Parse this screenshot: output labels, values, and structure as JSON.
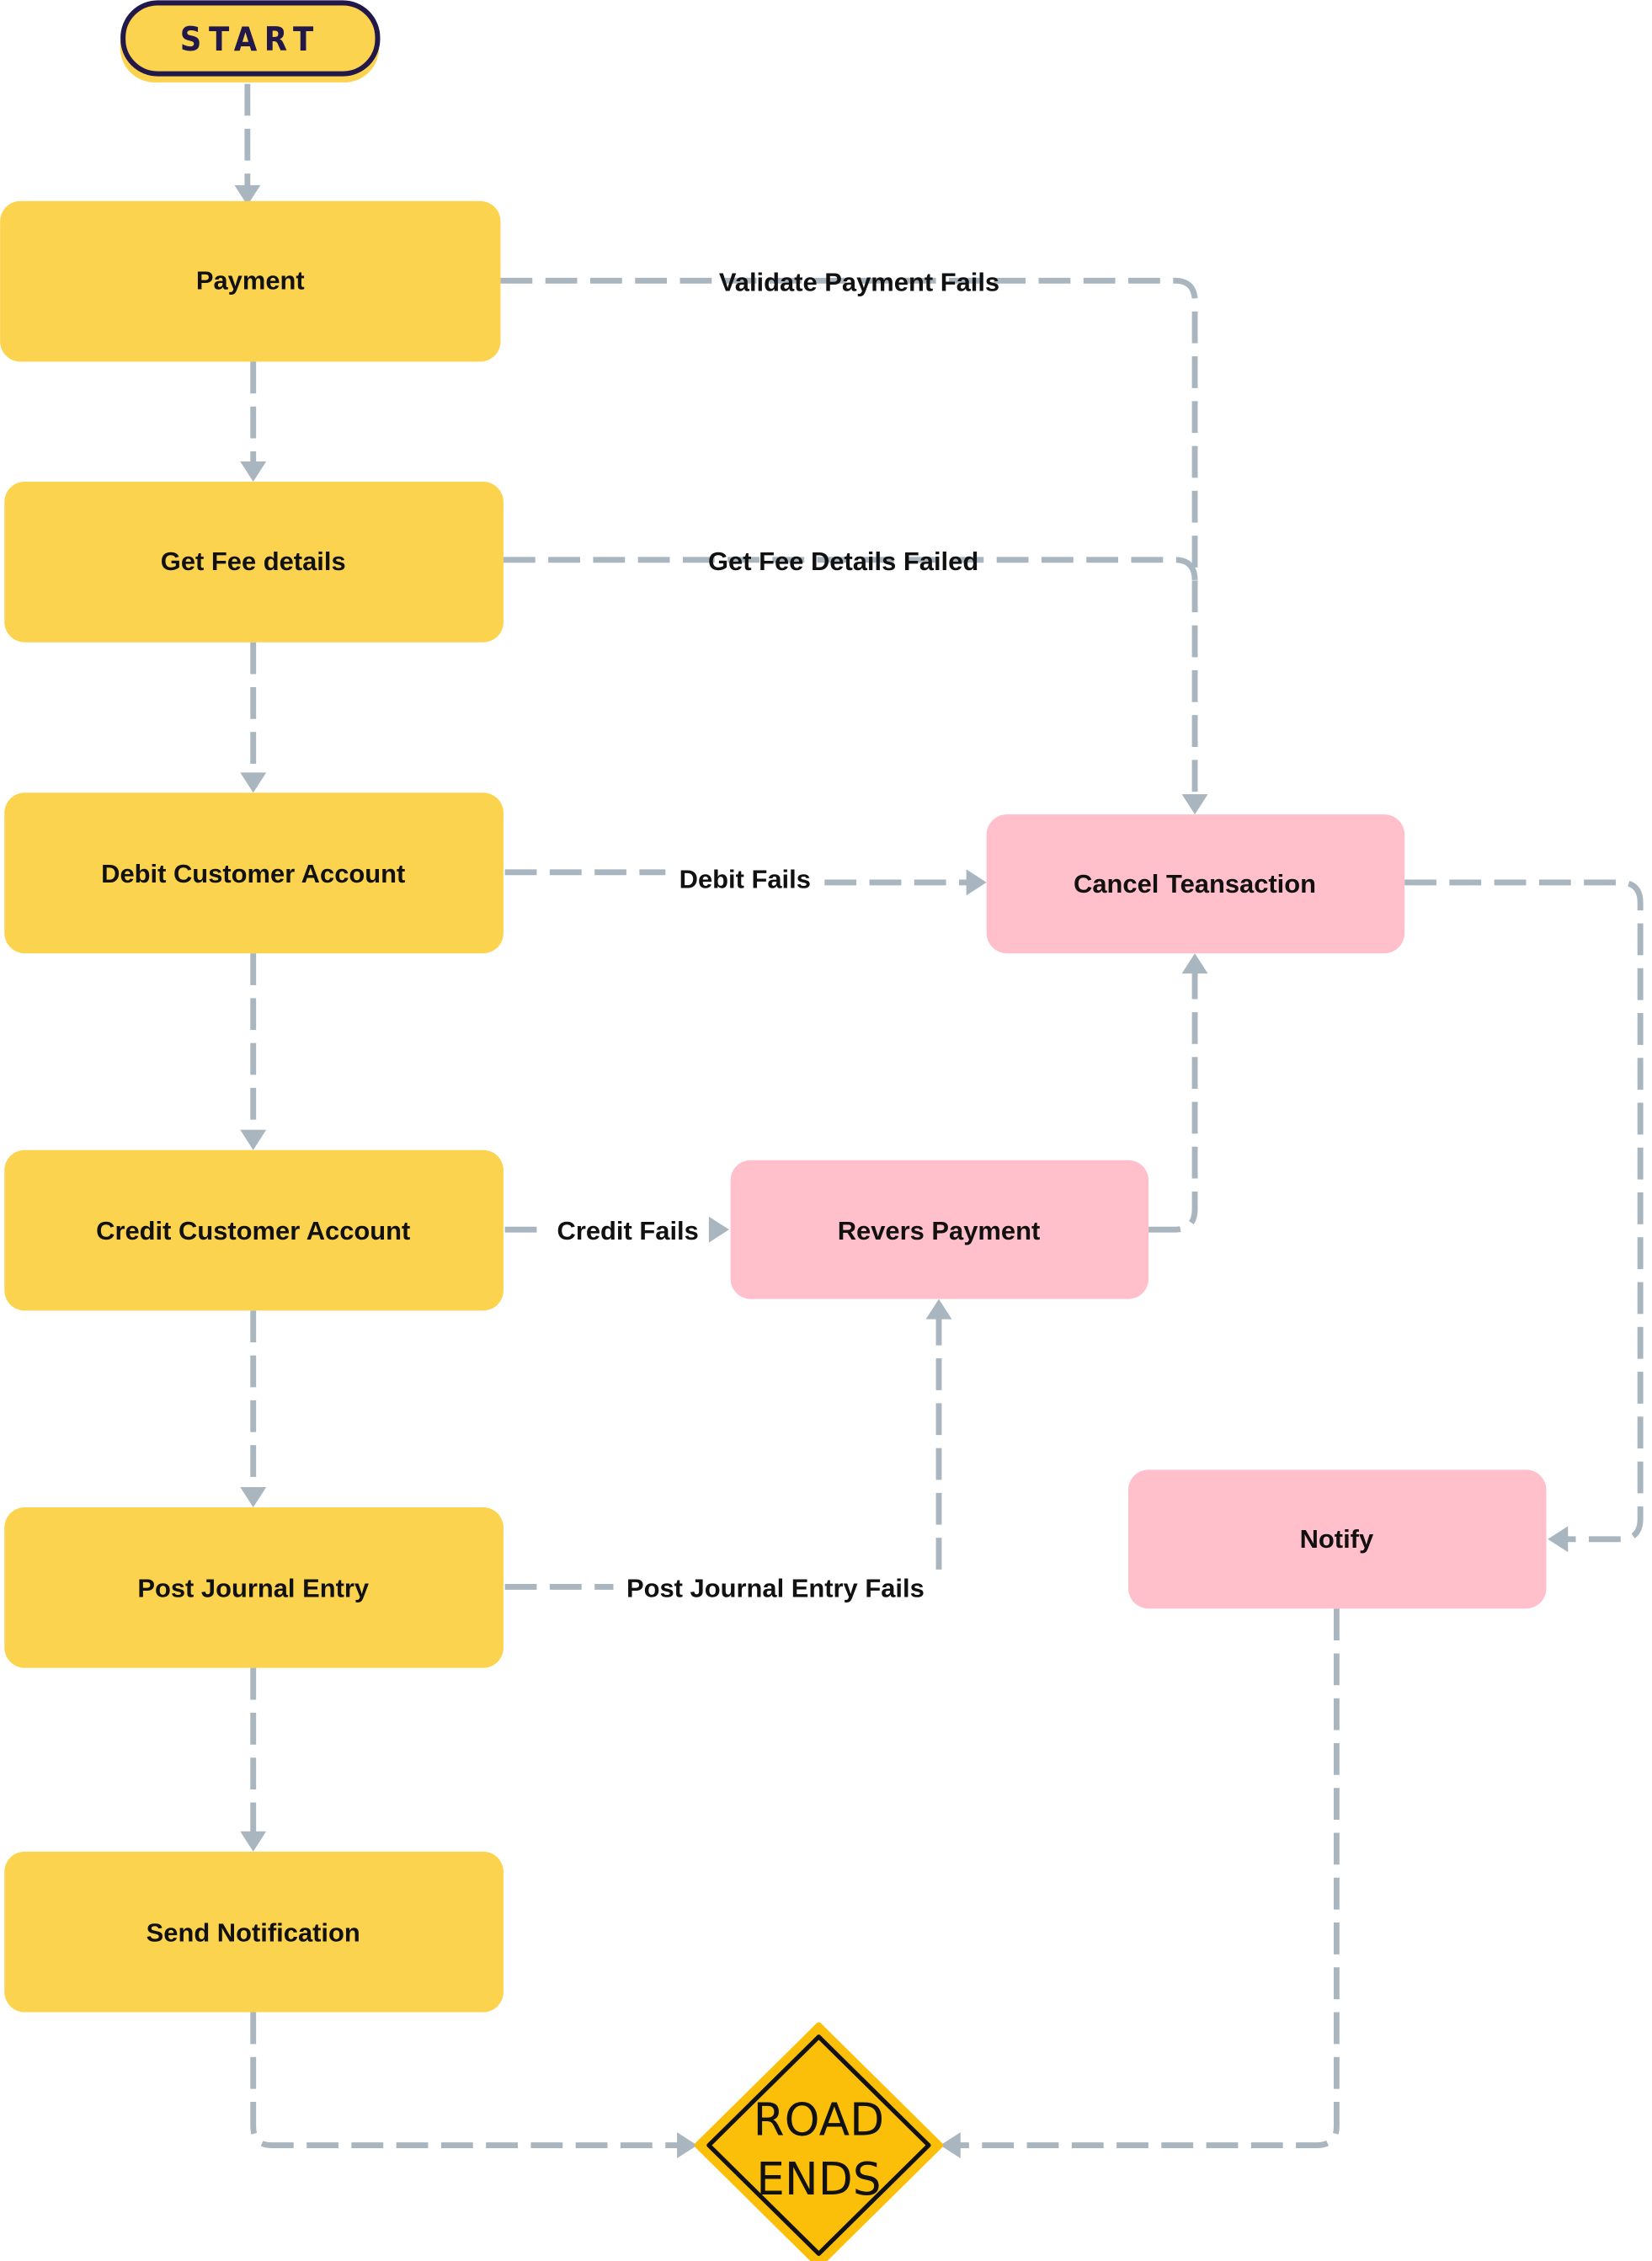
{
  "diagram": {
    "type": "flowchart",
    "colors": {
      "process_fill": "#fcd34f",
      "error_fill": "#ffbfcb",
      "connector": "#aab6bf",
      "start_outline": "#22194a",
      "sign_fill": "#fbbf0a"
    },
    "start": {
      "label": "START"
    },
    "end": {
      "label_line1": "ROAD",
      "label_line2": "ENDS"
    },
    "nodes": {
      "payment": "Payment",
      "get_fee_details": "Get Fee details",
      "debit_customer_account": "Debit Customer Account",
      "credit_customer_account": "Credit Customer Account",
      "post_journal_entry": "Post Journal Entry",
      "send_notification": "Send Notification",
      "cancel_transaction": "Cancel Teansaction",
      "revers_payment": "Revers Payment",
      "notify": "Notify"
    },
    "edge_labels": {
      "validate_payment_fails": "Validate Payment Fails",
      "get_fee_details_failed": "Get Fee Details Failed",
      "debit_fails": "Debit Fails",
      "credit_fails": "Credit Fails",
      "post_journal_entry_fails": "Post Journal Entry Fails"
    },
    "edges": [
      {
        "from": "START",
        "to": "Payment"
      },
      {
        "from": "Payment",
        "to": "Get Fee details"
      },
      {
        "from": "Get Fee details",
        "to": "Debit Customer Account"
      },
      {
        "from": "Debit Customer Account",
        "to": "Credit Customer Account"
      },
      {
        "from": "Credit Customer Account",
        "to": "Post Journal Entry"
      },
      {
        "from": "Post Journal Entry",
        "to": "Send Notification"
      },
      {
        "from": "Send Notification",
        "to": "ROAD ENDS"
      },
      {
        "from": "Payment",
        "to": "Cancel Teansaction",
        "label": "Validate Payment Fails"
      },
      {
        "from": "Get Fee details",
        "to": "Cancel Teansaction",
        "label": "Get Fee Details Failed"
      },
      {
        "from": "Debit Customer Account",
        "to": "Cancel Teansaction",
        "label": "Debit Fails"
      },
      {
        "from": "Credit Customer Account",
        "to": "Revers Payment",
        "label": "Credit Fails"
      },
      {
        "from": "Post Journal Entry",
        "to": "Revers Payment",
        "label": "Post Journal Entry Fails"
      },
      {
        "from": "Revers Payment",
        "to": "Cancel Teansaction"
      },
      {
        "from": "Cancel Teansaction",
        "to": "Notify"
      },
      {
        "from": "Notify",
        "to": "ROAD ENDS"
      }
    ]
  }
}
